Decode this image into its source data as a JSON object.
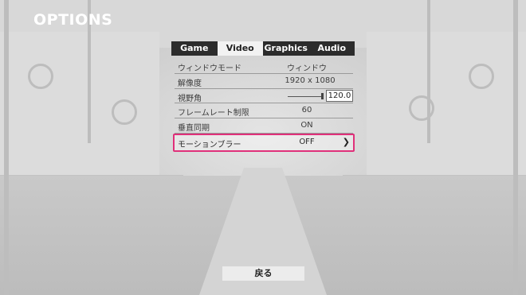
{
  "screen_title": "OPTIONS",
  "tabs": [
    {
      "label": "Game",
      "active": false
    },
    {
      "label": "Video",
      "active": true
    },
    {
      "label": "Graphics",
      "active": false
    },
    {
      "label": "Audio",
      "active": false
    }
  ],
  "settings": {
    "window_mode": {
      "label": "ウィンドウモード",
      "value": "ウィンドウ"
    },
    "resolution": {
      "label": "解像度",
      "value": "1920 x 1080"
    },
    "fov": {
      "label": "視野角",
      "value": "120.0"
    },
    "frame_limit": {
      "label": "フレームレート制限",
      "value": "60"
    },
    "vsync": {
      "label": "垂直同期",
      "value": "ON"
    },
    "motion_blur": {
      "label": "モーションブラー",
      "value": "OFF",
      "chevron": "❯"
    }
  },
  "selected_setting": "motion_blur",
  "highlight_color": "#e0307a",
  "back_label": "戻る"
}
